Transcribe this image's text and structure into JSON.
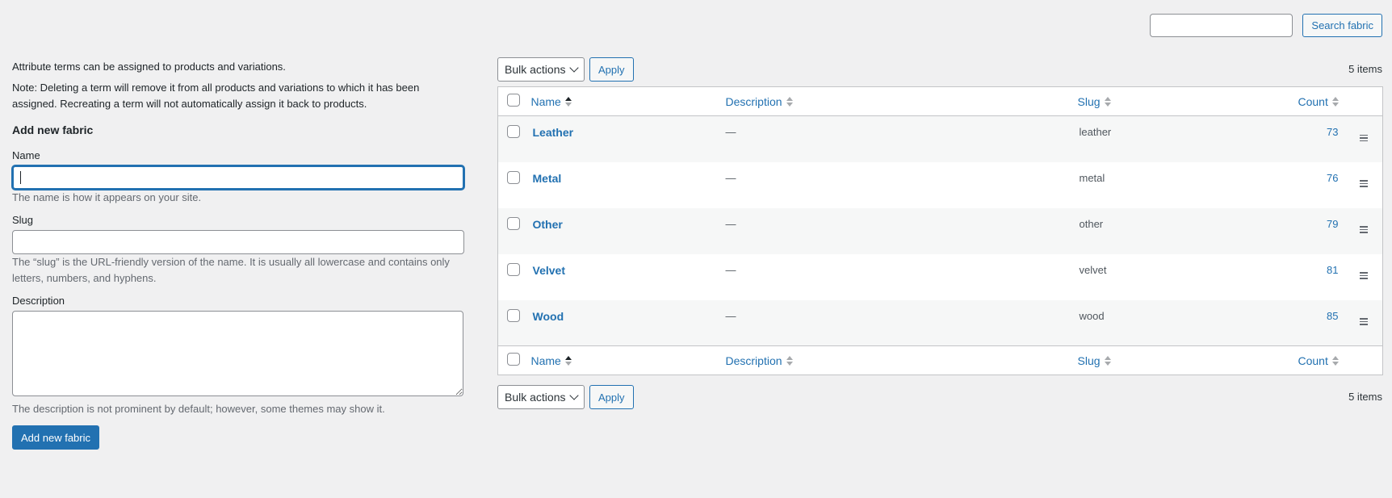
{
  "search": {
    "value": "",
    "button_label": "Search fabric"
  },
  "intro": {
    "line1": "Attribute terms can be assigned to products and variations.",
    "note": "Note: Deleting a term will remove it from all products and variations to which it has been assigned. Recreating a term will not automatically assign it back to products."
  },
  "form": {
    "title": "Add new fabric",
    "name_label": "Name",
    "name_value": "",
    "name_help": "The name is how it appears on your site.",
    "slug_label": "Slug",
    "slug_value": "",
    "slug_help": "The “slug” is the URL-friendly version of the name. It is usually all lowercase and contains only letters, numbers, and hyphens.",
    "description_label": "Description",
    "description_value": "",
    "description_help": "The description is not prominent by default; however, some themes may show it.",
    "submit_label": "Add new fabric"
  },
  "tablenav": {
    "bulk_label": "Bulk actions",
    "apply_label": "Apply",
    "items_count": "5 items"
  },
  "table": {
    "columns": {
      "name": "Name",
      "description": "Description",
      "slug": "Slug",
      "count": "Count"
    },
    "rows": [
      {
        "name": "Leather",
        "description": "—",
        "slug": "leather",
        "count": "73"
      },
      {
        "name": "Metal",
        "description": "—",
        "slug": "metal",
        "count": "76"
      },
      {
        "name": "Other",
        "description": "—",
        "slug": "other",
        "count": "79"
      },
      {
        "name": "Velvet",
        "description": "—",
        "slug": "velvet",
        "count": "81"
      },
      {
        "name": "Wood",
        "description": "—",
        "slug": "wood",
        "count": "85"
      }
    ]
  },
  "icons": {
    "sort": "sort-arrows-icon",
    "drag": "drag-handle-icon",
    "dropdown": "chevron-down-icon"
  },
  "colors": {
    "accent": "#2271b1",
    "background": "#f0f0f1"
  }
}
